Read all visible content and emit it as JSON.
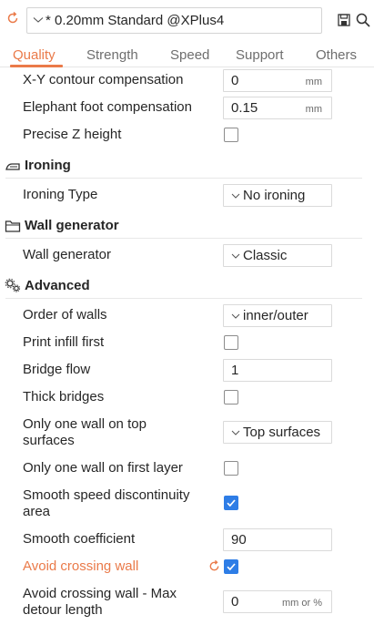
{
  "preset": {
    "name": "* 0.20mm Standard @XPlus4"
  },
  "tabs": [
    {
      "label": "Quality",
      "active": true
    },
    {
      "label": "Strength",
      "active": false
    },
    {
      "label": "Speed",
      "active": false
    },
    {
      "label": "Support",
      "active": false
    },
    {
      "label": "Others",
      "active": false
    }
  ],
  "rows": {
    "xy_contour": {
      "label": "X-Y contour compensation",
      "value": "0",
      "unit": "mm"
    },
    "elephant_foot": {
      "label": "Elephant foot compensation",
      "value": "0.15",
      "unit": "mm"
    },
    "precise_z": {
      "label": "Precise Z height",
      "checked": false
    },
    "ironing_type": {
      "label": "Ironing Type",
      "value": "No ironing"
    },
    "wall_generator": {
      "label": "Wall generator",
      "value": "Classic"
    },
    "order_of_walls": {
      "label": "Order of walls",
      "value": "inner/outer"
    },
    "print_infill_first": {
      "label": "Print infill first",
      "checked": false
    },
    "bridge_flow": {
      "label": "Bridge flow",
      "value": "1"
    },
    "thick_bridges": {
      "label": "Thick bridges",
      "checked": false
    },
    "one_wall_top": {
      "label_line1": "Only one wall on top",
      "label_line2": "surfaces",
      "value": "Top surfaces"
    },
    "one_wall_first": {
      "label": "Only one wall on first layer",
      "checked": false
    },
    "smooth_speed": {
      "label_line1": "Smooth speed discontinuity",
      "label_line2": "area",
      "checked": true
    },
    "smooth_coefficient": {
      "label": "Smooth coefficient",
      "value": "90"
    },
    "avoid_crossing": {
      "label": "Avoid crossing wall",
      "checked": true,
      "modified": true
    },
    "avoid_crossing_max": {
      "label_line1": "Avoid crossing wall - Max",
      "label_line2": "detour length",
      "value": "0",
      "unit": "mm or %"
    }
  },
  "sections": {
    "ironing": {
      "title": "Ironing",
      "icon": "iron-icon"
    },
    "wall_generator": {
      "title": "Wall generator",
      "icon": "folder-icon"
    },
    "advanced": {
      "title": "Advanced",
      "icon": "gears-icon"
    }
  },
  "colors": {
    "accent": "#ea7a49",
    "checkbox_on": "#2e7de6"
  }
}
